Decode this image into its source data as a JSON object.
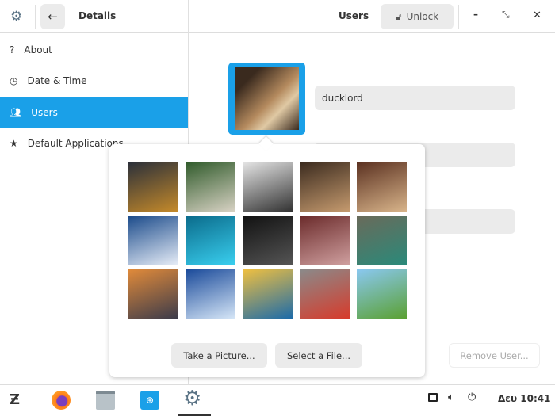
{
  "header": {
    "title": "Details",
    "page_title": "Users",
    "unlock_label": "Unlock"
  },
  "sidebar": {
    "items": [
      {
        "label": "About",
        "icon": "question-icon"
      },
      {
        "label": "Date & Time",
        "icon": "clock-icon"
      },
      {
        "label": "Users",
        "icon": "users-icon",
        "active": true
      },
      {
        "label": "Default Applications",
        "icon": "star-icon"
      }
    ]
  },
  "user": {
    "name": "ducklord"
  },
  "popover": {
    "photos": [
      "bicycle",
      "book",
      "calculator",
      "cat",
      "latte",
      "flower",
      "gamepad",
      "guitar",
      "headphones",
      "hummingbird",
      "mountain",
      "airplane-wing",
      "surfer",
      "tomatoes",
      "tree"
    ],
    "take_picture": "Take a Picture...",
    "select_file": "Select a File..."
  },
  "remove_user": "Remove User...",
  "taskbar": {
    "clock": "Δευ 10:41"
  },
  "colors": {
    "accent": "#1aa0e8"
  }
}
